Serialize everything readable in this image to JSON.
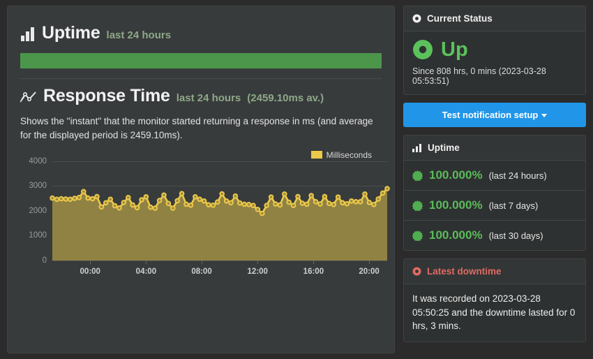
{
  "uptime_section": {
    "icon": "bar-chart-icon",
    "title": "Uptime",
    "subtitle": "last 24 hours",
    "bar_percent": "100"
  },
  "response_section": {
    "icon": "line-chart-icon",
    "title": "Response Time",
    "subtitle": "last 24 hours",
    "average_label": "(2459.10ms av.)",
    "description": "Shows the \"instant\" that the monitor started returning a response in ms (and average for the displayed period is 2459.10ms)."
  },
  "chart_data": {
    "type": "area",
    "title": "Response Time",
    "xlabel": "",
    "ylabel": "Milliseconds",
    "legend": [
      "Milliseconds"
    ],
    "legend_position": "top-right",
    "grid": true,
    "ylim": [
      0,
      4000
    ],
    "yticks": [
      0,
      1000,
      2000,
      3000,
      4000
    ],
    "ytick_labels": [
      "0",
      "1000",
      "2000",
      "3000",
      "4000"
    ],
    "xticks": [
      "00:00",
      "04:00",
      "08:00",
      "12:00",
      "16:00",
      "20:00"
    ],
    "xtick_positions": [
      0.113,
      0.28,
      0.446,
      0.613,
      0.78,
      0.946
    ],
    "series_color": "#edc94a",
    "fill_color": "#8f8243",
    "values": [
      2520,
      2470,
      2490,
      2480,
      2470,
      2510,
      2540,
      2780,
      2520,
      2490,
      2580,
      2160,
      2330,
      2470,
      2210,
      2120,
      2340,
      2540,
      2240,
      2130,
      2450,
      2570,
      2150,
      2110,
      2420,
      2640,
      2300,
      2110,
      2410,
      2700,
      2270,
      2230,
      2570,
      2470,
      2400,
      2250,
      2230,
      2360,
      2690,
      2400,
      2330,
      2600,
      2320,
      2270,
      2260,
      2220,
      2060,
      1900,
      2220,
      2560,
      2280,
      2240,
      2680,
      2350,
      2220,
      2580,
      2310,
      2270,
      2620,
      2370,
      2280,
      2580,
      2300,
      2260,
      2560,
      2330,
      2290,
      2400,
      2370,
      2370,
      2680,
      2340,
      2260,
      2480,
      2720,
      2900
    ]
  },
  "current_status": {
    "header_icon": "dot-circle-icon",
    "header": "Current Status",
    "status_icon": "dot-circle-icon",
    "status": "Up",
    "since": "Since 808 hrs, 0 mins (2023-03-28 05:53:51)"
  },
  "notification_button": {
    "label": "Test notification setup",
    "has_caret": true
  },
  "uptime_panel": {
    "header_icon": "bar-chart-icon",
    "header": "Uptime",
    "rows": [
      {
        "icon": "certificate-icon",
        "percent": "100.000%",
        "period": "(last 24 hours)"
      },
      {
        "icon": "certificate-icon",
        "percent": "100.000%",
        "period": "(last 7 days)"
      },
      {
        "icon": "certificate-icon",
        "percent": "100.000%",
        "period": "(last 30 days)"
      }
    ]
  },
  "latest_downtime": {
    "header_icon": "dot-circle-icon",
    "header": "Latest downtime",
    "text": "It was recorded on 2023-03-28 05:50:25 and the downtime lasted for 0 hrs, 3 mins."
  },
  "colors": {
    "accent_green": "#4c964c",
    "status_green": "#5bc15b",
    "chart_yellow": "#edc94a",
    "button_blue": "#2196e8",
    "danger_red": "#e06b63",
    "panel_bg": "#333636",
    "page_bg": "#2b2b2b"
  }
}
